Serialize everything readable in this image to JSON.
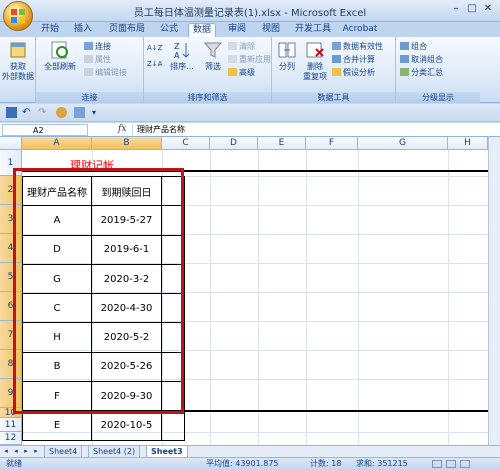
{
  "window": {
    "title": "员工每日体温测量记录表(1).xlsx - Microsoft Excel",
    "minimize": "–",
    "maximize": "□",
    "close": "✕"
  },
  "tabs": [
    "开始",
    "插入",
    "页面布局",
    "公式",
    "数据",
    "审阅",
    "视图",
    "开发工具",
    "Acrobat"
  ],
  "active_tab": "数据",
  "ribbon": {
    "get_external": {
      "label1": "获取",
      "label2": "外部数据"
    },
    "refresh_all": "全部刷新",
    "connections": "连接",
    "properties": "属性",
    "edit_links": "编辑链接",
    "group_connections": "连接",
    "sort": "排序...",
    "filter": "筛选",
    "clear": "清除",
    "reapply": "重新应用",
    "advanced": "高级",
    "group_sort_filter": "排序和筛选",
    "text_to_columns": "分列",
    "remove_duplicates1": "删除",
    "remove_duplicates2": "重复项",
    "data_validation": "数据有效性",
    "consolidate": "合并计算",
    "what_if": "假设分析",
    "group_data_tools": "数据工具",
    "group": "组合",
    "ungroup": "取消组合",
    "subtotal": "分类汇总",
    "group_outline": "分级显示",
    "sort_az": "A↓Z",
    "sort_za": "Z↓A"
  },
  "formula_bar": {
    "name_box": "A2",
    "fx": "fx",
    "value": "理财产品名称"
  },
  "columns": [
    "A",
    "B",
    "C",
    "D",
    "E",
    "F",
    "G",
    "H"
  ],
  "rows": [
    "1",
    "2",
    "3",
    "4",
    "5",
    "6",
    "7",
    "8",
    "9",
    "10",
    "11",
    "12"
  ],
  "sheet_title": "理财记帐",
  "table": {
    "headers": [
      "理财产品名称",
      "到期赎回日"
    ],
    "rows": [
      [
        "A",
        "2019-5-27"
      ],
      [
        "D",
        "2019-6-1"
      ],
      [
        "G",
        "2020-3-2"
      ],
      [
        "C",
        "2020-4-30"
      ],
      [
        "H",
        "2020-5-2"
      ],
      [
        "B",
        "2020-5-26"
      ],
      [
        "F",
        "2020-9-30"
      ],
      [
        "E",
        "2020-10-5"
      ]
    ]
  },
  "sheet_tabs": [
    "Sheet4",
    "Sheet4 (2)",
    "Sheet3"
  ],
  "active_sheet": "Sheet3",
  "status": {
    "mode": "就绪",
    "average": "平均值: 43901.875",
    "count": "计数: 18",
    "sum": "求和: 351215"
  },
  "colors": {
    "accent": "#c0141a",
    "title_red": "#ff0000",
    "ribbon_blue": "#15428b"
  }
}
